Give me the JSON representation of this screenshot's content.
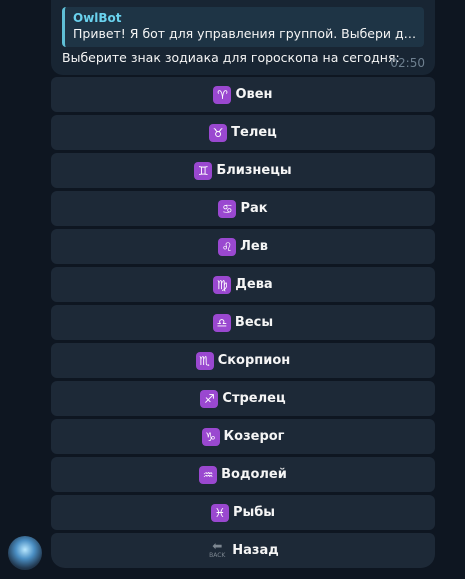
{
  "message": {
    "reply": {
      "sender": "OwlBot",
      "text": "Привет! Я бот для управления группой. Выбери дей..."
    },
    "text": "Выберите знак зодиака для гороскопа на сегодня:",
    "time": "02:50"
  },
  "keyboard": {
    "buttons": [
      {
        "icon": "♈",
        "label": "Овен",
        "icon_name": "aries-icon"
      },
      {
        "icon": "♉",
        "label": "Телец",
        "icon_name": "taurus-icon"
      },
      {
        "icon": "♊",
        "label": "Близнецы",
        "icon_name": "gemini-icon"
      },
      {
        "icon": "♋",
        "label": "Рак",
        "icon_name": "cancer-icon"
      },
      {
        "icon": "♌",
        "label": "Лев",
        "icon_name": "leo-icon"
      },
      {
        "icon": "♍",
        "label": "Дева",
        "icon_name": "virgo-icon"
      },
      {
        "icon": "♎",
        "label": "Весы",
        "icon_name": "libra-icon"
      },
      {
        "icon": "♏",
        "label": "Скорпион",
        "icon_name": "scorpio-icon"
      },
      {
        "icon": "♐",
        "label": "Стрелец",
        "icon_name": "sagittarius-icon"
      },
      {
        "icon": "♑",
        "label": "Козерог",
        "icon_name": "capricorn-icon"
      },
      {
        "icon": "♒",
        "label": "Водолей",
        "icon_name": "aquarius-icon"
      },
      {
        "icon": "♓",
        "label": "Рыбы",
        "icon_name": "pisces-icon"
      }
    ],
    "back": {
      "label": "Назад",
      "icon_name": "back-arrow-icon"
    }
  },
  "colors": {
    "background": "#0e1621",
    "bubble": "#182533",
    "button": "#1d2937",
    "zodiac_icon": "#9a48d0",
    "sender": "#6ad2ee"
  }
}
